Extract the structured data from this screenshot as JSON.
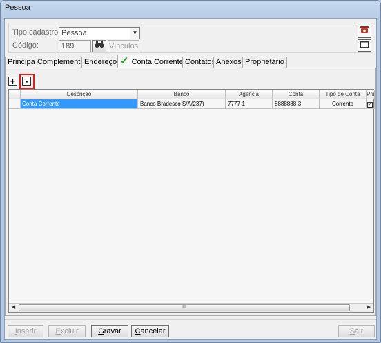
{
  "window": {
    "title": "Pessoa"
  },
  "header": {
    "tipo_label": "Tipo cadastro",
    "tipo_value": "Pessoa",
    "codigo_label": "Código:",
    "codigo_value": "189",
    "vinculos_label": "Vínculos",
    "phone_icon": "phone-icon",
    "window_icon": "window-icon"
  },
  "tabs": [
    {
      "label": "Principal"
    },
    {
      "label": "Complementar"
    },
    {
      "label": "Endereços"
    },
    {
      "label": "Conta Corrente",
      "active": true
    },
    {
      "label": "Contatos"
    },
    {
      "label": "Anexos"
    },
    {
      "label": "Proprietário"
    }
  ],
  "toolbar": {
    "add_label": "+",
    "remove_label": "-"
  },
  "grid": {
    "columns": [
      "Descrição",
      "Banco",
      "Agência",
      "Conta",
      "Tipo de Conta",
      "Princ"
    ],
    "rows": [
      [
        "Conta Corrente",
        "Banco Bradesco S/A(237)",
        "7777-1",
        "8888888-3",
        "Corrente",
        ""
      ]
    ],
    "scroll_grip": "III"
  },
  "buttons": {
    "inserir": {
      "first": "I",
      "rest": "nserir"
    },
    "excluir": {
      "first": "E",
      "rest": "xcluir"
    },
    "gravar": {
      "first": "G",
      "rest": "ravar"
    },
    "cancelar": {
      "first": "C",
      "rest": "ancelar"
    },
    "sair": {
      "first": "S",
      "rest": "air"
    }
  },
  "colors": {
    "selection": "#3399ff",
    "highlight_box": "#e02020",
    "check": "#2b9a2b"
  }
}
